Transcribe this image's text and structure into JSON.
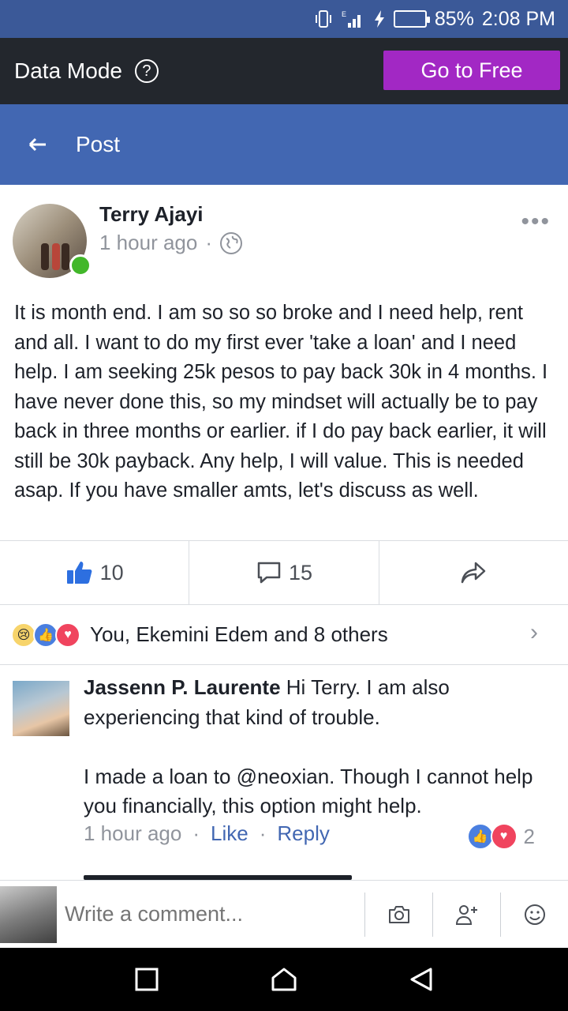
{
  "status_bar": {
    "battery_percent": "85%",
    "time": "2:08 PM",
    "battery_level": 0.85
  },
  "data_mode": {
    "label": "Data Mode",
    "go_free_label": "Go to Free"
  },
  "header": {
    "title": "Post"
  },
  "post": {
    "author": "Terry Ajayi",
    "time": "1 hour ago",
    "separator": "·",
    "more": "•••",
    "text": "It is month end. I am so so so broke and I need help, rent and all. I want to do my first ever 'take a loan' and I need help. I am seeking 25k pesos to pay back 30k in 4 months. I have never done this, so my mindset will actually be to pay back in three months or earlier. if I do pay back earlier, it will still be 30k payback. Any help, I will value. This is needed asap. If you have smaller amts, let's discuss as well.",
    "like_count": "10",
    "comment_count": "15"
  },
  "reactions": {
    "summary": "You, Ekemini Edem and 8 others"
  },
  "comment": {
    "author": "Jassenn P. Laurente",
    "text_part1": "Hi Terry. I am also experiencing that kind of trouble.",
    "text_part2": "I made a loan to @neoxian. Though I cannot help you financially, this option might help.",
    "time": "1 hour ago",
    "separator": "·",
    "like_label": "Like",
    "reply_label": "Reply",
    "reaction_count": "2"
  },
  "composer": {
    "placeholder": "Write a comment..."
  }
}
